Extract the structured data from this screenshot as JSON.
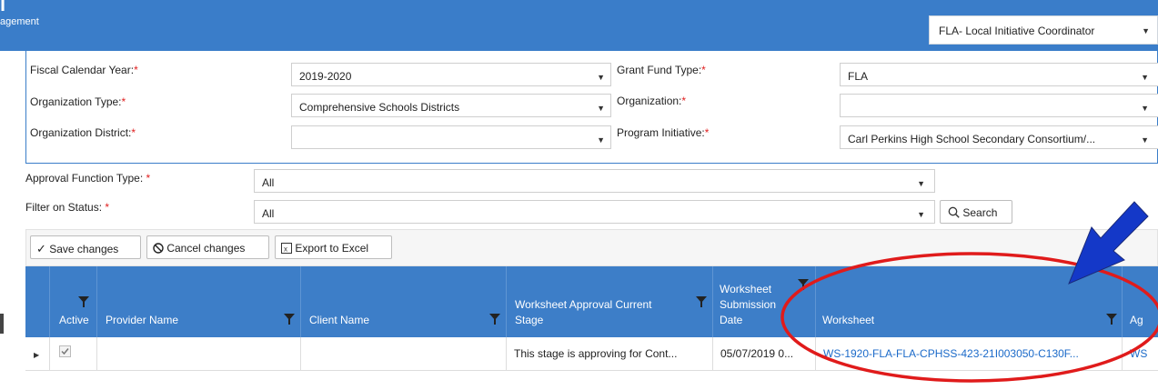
{
  "header": {
    "app_title_fragment": "agement",
    "role_select": "FLA- Local Initiative Coordinator"
  },
  "form": {
    "fiscal_year_label": "Fiscal Calendar Year:",
    "fiscal_year_value": "2019-2020",
    "grant_fund_label": "Grant Fund Type:",
    "grant_fund_value": "FLA",
    "org_type_label": "Organization Type:",
    "org_type_value": "Comprehensive Schools Districts",
    "organization_label": "Organization:",
    "organization_value": "",
    "org_district_label": "Organization District:",
    "org_district_value": "",
    "program_initiative_label": "Program Initiative:",
    "program_initiative_value": "Carl Perkins High School Secondary Consortium/...",
    "required_mark": "*"
  },
  "filters": {
    "approval_function_label": "Approval Function Type:",
    "approval_function_value": "All",
    "status_label": "Filter on Status:",
    "status_value": "All",
    "search_label": "Search"
  },
  "toolbar": {
    "save_label": "Save changes",
    "cancel_label": "Cancel changes",
    "export_label": "Export to Excel"
  },
  "grid": {
    "columns": {
      "active": "Active",
      "provider": "Provider Name",
      "client": "Client Name",
      "stage_line1": "Worksheet Approval Current",
      "stage_line2": "Stage",
      "date_line1": "Worksheet",
      "date_line2": "Submission",
      "date_line3": "Date",
      "worksheet": "Worksheet",
      "ag": "Ag"
    },
    "rows": [
      {
        "active": true,
        "provider": "",
        "client": "",
        "stage": "This stage is approving for Cont...",
        "date": "05/07/2019 0...",
        "worksheet": "WS-1920-FLA-FLA-CPHSS-423-21I003050-C130F...",
        "ag": "WS"
      }
    ]
  },
  "colors": {
    "header_blue": "#3a7dc9",
    "annotation_arrow": "#1438c8",
    "annotation_circle": "#e01b1b"
  }
}
